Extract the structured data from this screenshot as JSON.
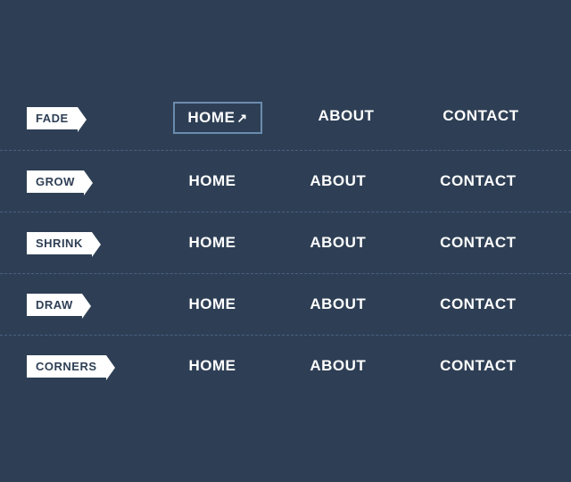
{
  "rows": [
    {
      "id": "fade",
      "label": "FADE",
      "items": [
        {
          "text": "HOME",
          "active": true
        },
        {
          "text": "ABOUT",
          "active": false
        },
        {
          "text": "CONTACT",
          "active": false
        }
      ]
    },
    {
      "id": "grow",
      "label": "GROW",
      "items": [
        {
          "text": "HOME",
          "active": false
        },
        {
          "text": "ABOUT",
          "active": false
        },
        {
          "text": "CONTACT",
          "active": false
        }
      ]
    },
    {
      "id": "shrink",
      "label": "SHRINK",
      "items": [
        {
          "text": "HOME",
          "active": false
        },
        {
          "text": "ABOUT",
          "active": false
        },
        {
          "text": "CONTACT",
          "active": false
        }
      ]
    },
    {
      "id": "draw",
      "label": "DRAW",
      "items": [
        {
          "text": "HOME",
          "active": false
        },
        {
          "text": "ABOUT",
          "active": false
        },
        {
          "text": "CONTACT",
          "active": false
        }
      ]
    },
    {
      "id": "corners",
      "label": "CORNERS",
      "items": [
        {
          "text": "HOME",
          "active": false
        },
        {
          "text": "ABOUT",
          "active": false
        },
        {
          "text": "CONTACT",
          "active": false
        }
      ]
    }
  ]
}
